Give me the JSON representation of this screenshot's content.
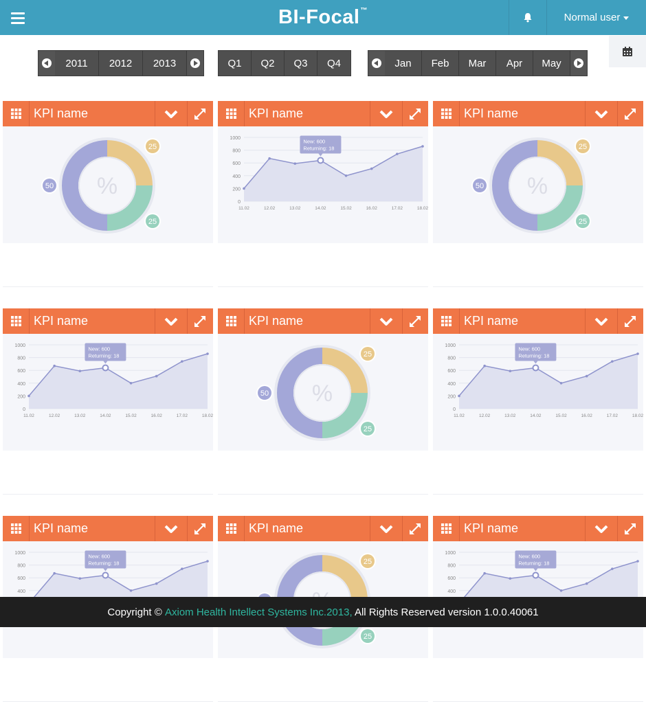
{
  "header": {
    "menu_icon": "hamburger-icon",
    "logo_text": "BI-Focal",
    "logo_mark": "™",
    "bell_icon": "bell-icon",
    "user_label": "Normal user",
    "user_caret_icon": "caret-down-icon",
    "bg_color": "#3fa0bf"
  },
  "filters": {
    "years": [
      "2011",
      "2012",
      "2013"
    ],
    "quarters": [
      "Q1",
      "Q2",
      "Q3",
      "Q4"
    ],
    "months": [
      "Jan",
      "Feb",
      "Mar",
      "Apr",
      "May"
    ],
    "calendar_icon": "calendar-icon"
  },
  "widget_header_color": "#f07646",
  "widgets": [
    {
      "title": "KPI name",
      "type": "donut"
    },
    {
      "title": "KPI name",
      "type": "area"
    },
    {
      "title": "KPI name",
      "type": "donut"
    },
    {
      "title": "KPI name",
      "type": "area"
    },
    {
      "title": "KPI name",
      "type": "donut"
    },
    {
      "title": "KPI name",
      "type": "area"
    },
    {
      "title": "KPI name",
      "type": "area"
    },
    {
      "title": "KPI name",
      "type": "donut"
    },
    {
      "title": "KPI name",
      "type": "area"
    }
  ],
  "donut": {
    "center_label": "%",
    "segments": [
      {
        "label": "50",
        "value": 50,
        "color": "#a3a7d8"
      },
      {
        "label": "25",
        "value": 25,
        "color": "#e8c88a"
      },
      {
        "label": "25",
        "value": 25,
        "color": "#97d1bd"
      }
    ]
  },
  "area_chart": {
    "x_labels": [
      "11.02",
      "12.02",
      "13.02",
      "14.02",
      "15.02",
      "16.02",
      "17.02",
      "18.02"
    ],
    "y_ticks": [
      "0",
      "200",
      "400",
      "600",
      "800",
      "1000"
    ],
    "y_max": 1000,
    "values": [
      200,
      670,
      590,
      640,
      400,
      510,
      740,
      860
    ],
    "tooltip_index": 3,
    "tooltip_line1": "New: 600",
    "tooltip_line2": "Returning: 18",
    "line_color": "#8e93cc",
    "fill_color": "#dfe1f0"
  },
  "footer": {
    "prefix": "Copyright © ",
    "company": "Axiom Health Intellect Systems Inc.2013,",
    "suffix": " All Rights Reserved version 1.0.0.40061"
  }
}
